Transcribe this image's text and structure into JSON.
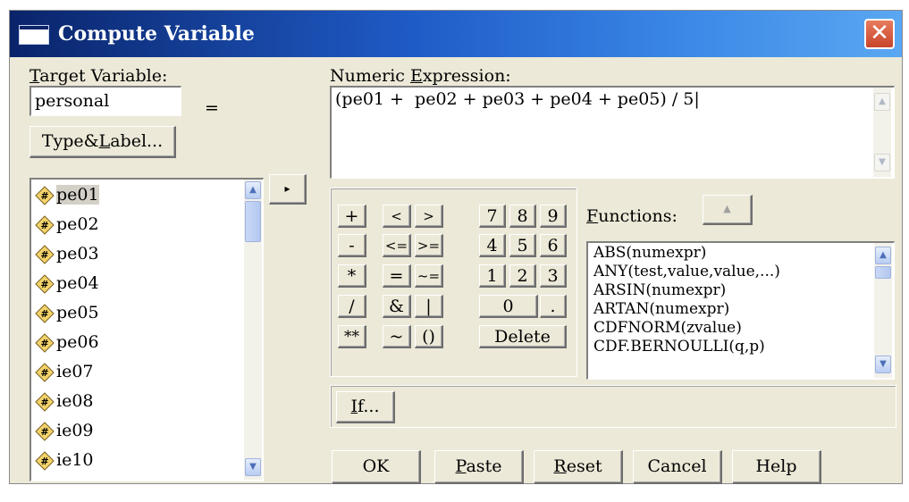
{
  "window": {
    "title": "Compute Variable",
    "close_glyph": "✕"
  },
  "target": {
    "label_u": "T",
    "label_rest": "arget Variable:",
    "value": "personal",
    "equals": "=",
    "type_label_pre": "Type&",
    "type_label_u": "L",
    "type_label_post": "abel..."
  },
  "variables": [
    "pe01",
    "pe02",
    "pe03",
    "pe04",
    "pe05",
    "pe06",
    "ie07",
    "ie08",
    "ie09",
    "ie10"
  ],
  "move_arrow": "▸",
  "expression": {
    "label_pre": "Numeric ",
    "label_u": "E",
    "label_post": "xpression:",
    "value": "(pe01 +  pe02 + pe03 + pe04 + pe05) / 5|"
  },
  "keypad": {
    "ops": {
      "plus": "+",
      "lt": "<",
      "gt": ">",
      "minus": "-",
      "le": "<=",
      "ge": ">=",
      "mul": "*",
      "eq": "=",
      "ne": "~=",
      "div": "/",
      "and": "&",
      "or": "|",
      "pow": "**",
      "not": "~",
      "paren": "()"
    },
    "digits": [
      "7",
      "8",
      "9",
      "4",
      "5",
      "6",
      "1",
      "2",
      "3"
    ],
    "zero": "0",
    "dot": ".",
    "delete": "Delete"
  },
  "functions": {
    "label_u": "F",
    "label_rest": "unctions:",
    "up_glyph": "▲",
    "items": [
      "ABS(numexpr)",
      "ANY(test,value,value,...)",
      "ARSIN(numexpr)",
      "ARTAN(numexpr)",
      "CDFNORM(zvalue)",
      "CDF.BERNOULLI(q,p)"
    ]
  },
  "if_button": {
    "u": "I",
    "rest": "f..."
  },
  "buttons": {
    "ok": "OK",
    "paste_u": "P",
    "paste_rest": "aste",
    "reset_u": "R",
    "reset_rest": "eset",
    "cancel": "Cancel",
    "help": "Help"
  },
  "colors": {
    "titlebar": "#1f5bc6",
    "dialog": "#ece9d8",
    "close": "#d9553a"
  }
}
